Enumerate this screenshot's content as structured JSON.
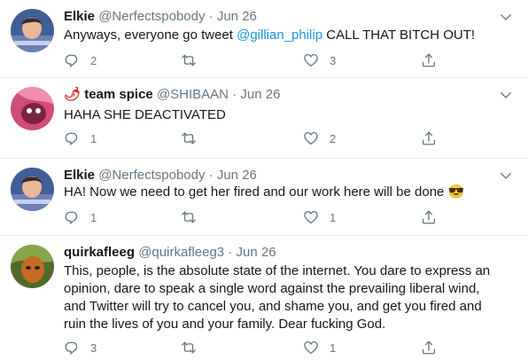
{
  "tweets": [
    {
      "name": "Elkie",
      "handle": "@Nerfectspobody",
      "dot": "·",
      "date": "Jun 26",
      "text_before": "Anyways, everyone go tweet ",
      "mention": "@gillian_philip",
      "text_after": " CALL THAT BITCH OUT!",
      "reply_count": "2",
      "retweet_count": "",
      "like_count": "3"
    },
    {
      "name_emoji": "🌶",
      "name": "team spice",
      "handle": "@SHIBAAN",
      "dot": "·",
      "date": "Jun 26",
      "text": "HAHA SHE DEACTIVATED",
      "reply_count": "1",
      "retweet_count": "",
      "like_count": "2"
    },
    {
      "name": "Elkie",
      "handle": "@Nerfectspobody",
      "dot": "·",
      "date": "Jun 26",
      "text": "HA! Now we need to get her fired and our work here will be done ",
      "text_emoji": "😎",
      "reply_count": "1",
      "retweet_count": "",
      "like_count": "1"
    },
    {
      "name": "quirkafleeg",
      "handle": "@quirkafleeg3",
      "dot": "·",
      "date": "Jun 26",
      "lines": [
        "This, people, is the absolute state of the internet. You dare to express an",
        "opinion, dare to speak a single word against the prevailing liberal wind,",
        "and Twitter will try to cancel you, and shame you, and get you fired and",
        "ruin the lives of you and your family. Dear fucking God."
      ],
      "reply_count": "3",
      "retweet_count": "",
      "like_count": "1"
    }
  ],
  "icons": {
    "reply": "reply-icon",
    "retweet": "retweet-icon",
    "like": "heart-icon",
    "share": "share-icon",
    "caret": "chevron-down-icon"
  },
  "colors": {
    "text": "#14171a",
    "secondary": "#657786",
    "link": "#1b95e0",
    "divider": "#e6ecf0"
  }
}
